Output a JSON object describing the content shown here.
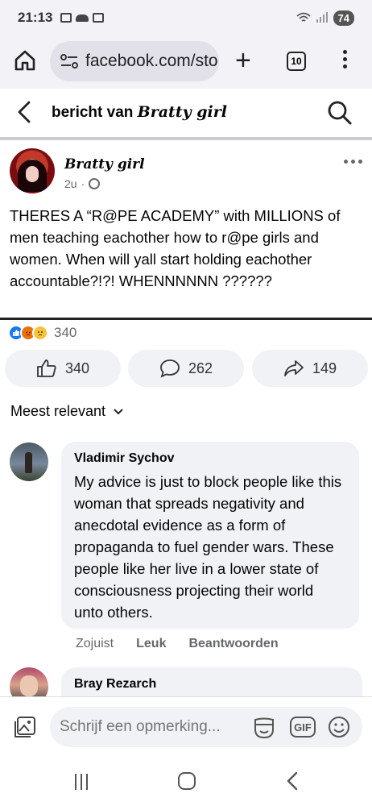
{
  "status_bar": {
    "time": "21:13",
    "battery": "74"
  },
  "browser": {
    "url": "facebook.com/sto",
    "tab_count": "10"
  },
  "header": {
    "title_prefix": "bericht van",
    "title_brand": "Bratty girl"
  },
  "post": {
    "author": "Bratty girl",
    "time": "2u",
    "separator": "·",
    "text": "THERES A “R@PE ACADEMY” with MILLIONS of men teaching eachother how to r@pe girls and women. When will yall start holding eachother accountable?!?! WHENNNNNN ??????",
    "reaction_count": "340",
    "like_count": "340",
    "comment_count": "262",
    "share_count": "149"
  },
  "comments_section": {
    "sort_label": "Meest relevant"
  },
  "comments": [
    {
      "name": "Vladimir Sychov",
      "text": "My advice is just to block people like this woman that spreads negativity and anecdotal evidence as a form of propaganda to fuel gender wars. These people like her live in a lower state of consciousness projecting their world unto others.",
      "time": "Zojuist",
      "like_label": "Leuk",
      "reply_label": "Beantwoorden"
    },
    {
      "name": "Bray Rezarch"
    }
  ],
  "composer": {
    "placeholder": "Schrijf een opmerking...",
    "gif_label": "GIF"
  },
  "colors": {
    "accent": "#1877f2",
    "bubble": "#f0f2f5",
    "muted_text": "#65676b"
  }
}
